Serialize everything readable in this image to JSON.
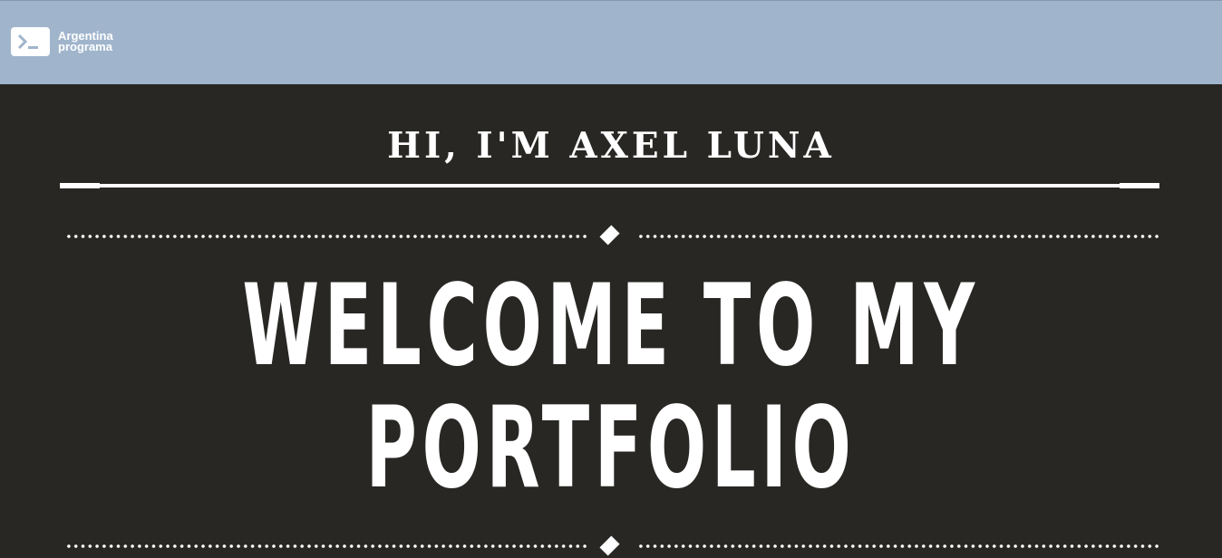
{
  "header": {
    "logo": {
      "icon": "terminal-prompt-icon",
      "line1": "Argentina",
      "line2": "programa"
    },
    "background": "#a0b5cc"
  },
  "hero": {
    "greeting": "HI, I'M AXEL LUNA",
    "title_line1": "WELCOME TO MY",
    "title_line2": "PORTFOLIO",
    "background": "#282724",
    "text_color": "#ffffff"
  }
}
